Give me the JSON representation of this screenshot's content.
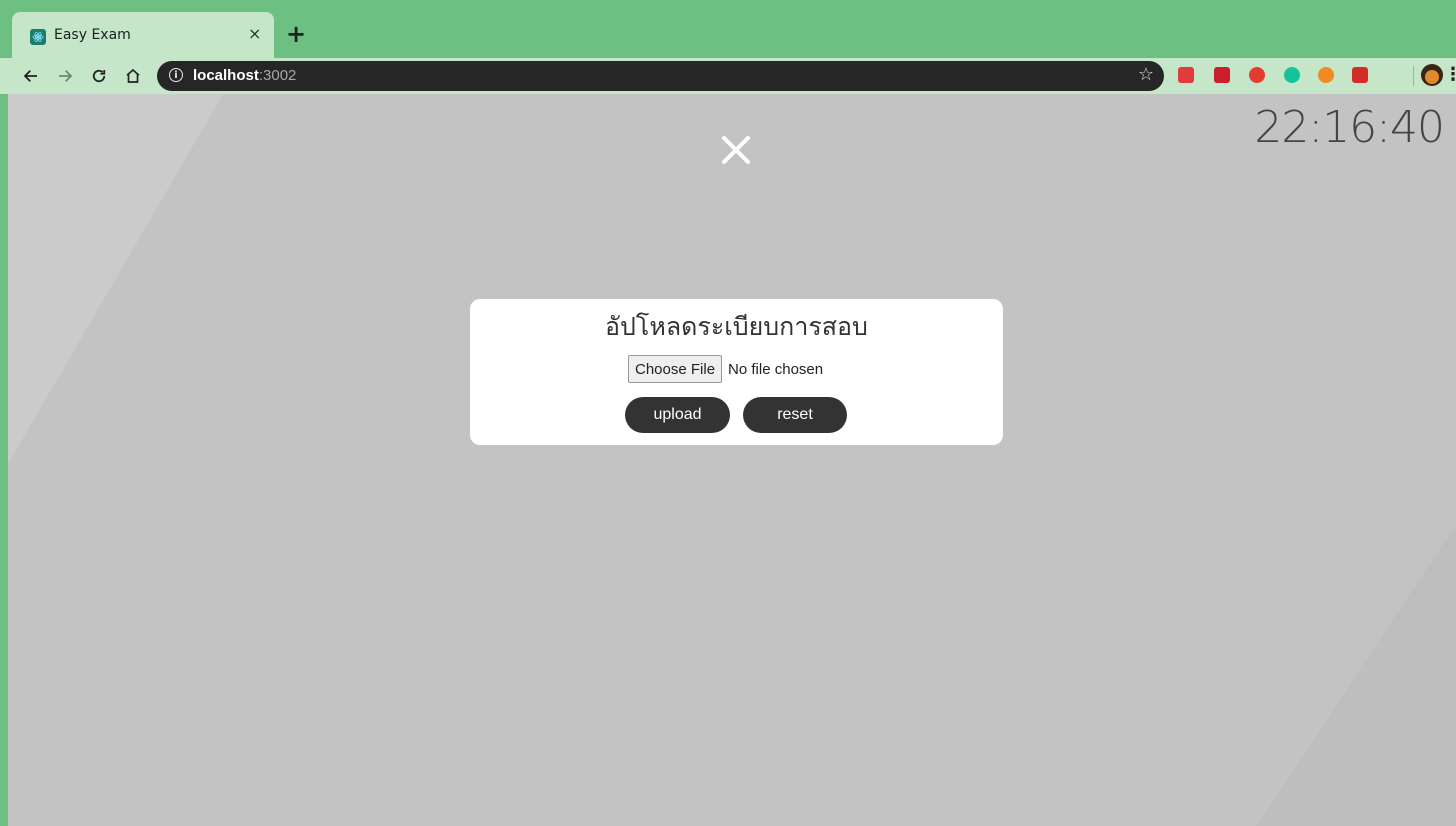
{
  "browser": {
    "tab_title": "Easy Exam",
    "tab_close": "×",
    "new_tab": "+",
    "url_host": "localhost",
    "url_port": ":3002",
    "favicon": "react-atom-icon",
    "extensions": [
      {
        "name": "ext-red-icon",
        "color": "#e23b3b"
      },
      {
        "name": "ext-flag-icon",
        "color": "#c9202c"
      },
      {
        "name": "ext-shield-icon",
        "color": "#e33b2e"
      },
      {
        "name": "ext-grammarly-icon",
        "color": "#15c39a"
      },
      {
        "name": "ext-orange-icon",
        "color": "#f08a24"
      },
      {
        "name": "ext-lastpass-icon",
        "color": "#d32d27"
      }
    ]
  },
  "page": {
    "clock": "22:16:40",
    "modal": {
      "title": "อัปโหลดระเบียบการสอบ",
      "choose_file_label": "Choose File",
      "file_status": "No file chosen",
      "upload_label": "upload",
      "reset_label": "reset"
    }
  },
  "colors": {
    "tabstrip": "#6dbf82",
    "toolbar": "#c5e6c9",
    "page_bg": "#c3c3c3",
    "button_bg": "#333333"
  }
}
